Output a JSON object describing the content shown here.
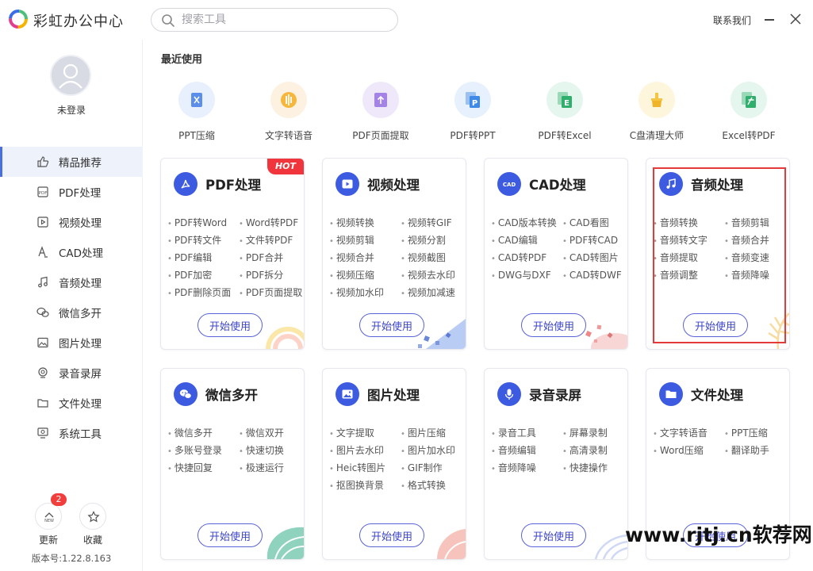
{
  "app": {
    "title": "彩虹办公中心",
    "search_placeholder": "搜索工具",
    "contact_label": "联系我们"
  },
  "sidebar": {
    "login_text": "未登录",
    "items": [
      {
        "label": "精品推荐",
        "icon": "thumbs-up-icon",
        "active": true
      },
      {
        "label": "PDF处理",
        "icon": "pdf-icon"
      },
      {
        "label": "视频处理",
        "icon": "video-icon"
      },
      {
        "label": "CAD处理",
        "icon": "cad-icon"
      },
      {
        "label": "音频处理",
        "icon": "music-icon"
      },
      {
        "label": "微信多开",
        "icon": "wechat-icon"
      },
      {
        "label": "图片处理",
        "icon": "image-icon"
      },
      {
        "label": "录音录屏",
        "icon": "record-icon"
      },
      {
        "label": "文件处理",
        "icon": "folder-icon"
      },
      {
        "label": "系统工具",
        "icon": "system-icon"
      }
    ],
    "update_label": "更新",
    "update_badge": "2",
    "favorite_label": "收藏",
    "version": "版本号:1.22.8.163"
  },
  "recent": {
    "title": "最近使用",
    "items": [
      {
        "label": "PPT压缩",
        "icon": "ppt-compress-icon",
        "color": "#e7f0fc"
      },
      {
        "label": "文字转语音",
        "icon": "text-to-speech-icon",
        "color": "#fdf2e2"
      },
      {
        "label": "PDF页面提取",
        "icon": "pdf-extract-icon",
        "color": "#efe8fb"
      },
      {
        "label": "PDF转PPT",
        "icon": "pdf-to-ppt-icon",
        "color": "#e6f1fd"
      },
      {
        "label": "PDF转Excel",
        "icon": "pdf-to-excel-icon",
        "color": "#e4f6ee"
      },
      {
        "label": "C盘清理大师",
        "icon": "disk-clean-icon",
        "color": "#fdf5dc"
      },
      {
        "label": "Excel转PDF",
        "icon": "excel-to-pdf-icon",
        "color": "#e4f6ee"
      }
    ]
  },
  "cards": [
    {
      "title": "PDF处理",
      "hot": "HOT",
      "icon": "pdf-logo-icon",
      "color": "#3d5be0",
      "features": [
        "PDF转Word",
        "Word转PDF",
        "PDF转文件",
        "文件转PDF",
        "PDF编辑",
        "PDF合并",
        "PDF加密",
        "PDF拆分",
        "PDF删除页面",
        "PDF页面提取"
      ]
    },
    {
      "title": "视频处理",
      "icon": "video-play-icon",
      "color": "#3d5be0",
      "features": [
        "视频转换",
        "视频转GIF",
        "视频剪辑",
        "视频分割",
        "视频合并",
        "视频截图",
        "视频压缩",
        "视频去水印",
        "视频加水印",
        "视频加减速"
      ]
    },
    {
      "title": "CAD处理",
      "icon": "cad-logo-icon",
      "color": "#3d5be0",
      "icon_text": "CAD",
      "features": [
        "CAD版本转换",
        "CAD看图",
        "CAD编辑",
        "PDF转CAD",
        "CAD转PDF",
        "CAD转图片",
        "DWG与DXF",
        "CAD转DWF"
      ]
    },
    {
      "title": "音频处理",
      "icon": "music-note-icon",
      "color": "#3d5be0",
      "features": [
        "音频转换",
        "音频剪辑",
        "音频转文字",
        "音频合并",
        "音频提取",
        "音频变速",
        "音频调整",
        "音频降噪"
      ]
    },
    {
      "title": "微信多开",
      "icon": "wechat-logo-icon",
      "color": "#3d5be0",
      "features": [
        "微信多开",
        "微信双开",
        "多账号登录",
        "快速切换",
        "快捷回复",
        "极速运行"
      ]
    },
    {
      "title": "图片处理",
      "icon": "picture-icon",
      "color": "#3d5be0",
      "features": [
        "文字提取",
        "图片压缩",
        "图片去水印",
        "图片加水印",
        "Heic转图片",
        "GIF制作",
        "抠图换背景",
        "格式转换"
      ]
    },
    {
      "title": "录音录屏",
      "icon": "microphone-icon",
      "color": "#3d5be0",
      "features": [
        "录音工具",
        "屏幕录制",
        "音频编辑",
        "高清录制",
        "音频降噪",
        "快捷操作"
      ]
    },
    {
      "title": "文件处理",
      "icon": "folder-logo-icon",
      "color": "#3d5be0",
      "features": [
        "文字转语音",
        "PPT压缩",
        "Word压缩",
        "翻译助手"
      ]
    }
  ],
  "start_label": "开始使用",
  "watermark": "www.rjtj.cn软荐网"
}
